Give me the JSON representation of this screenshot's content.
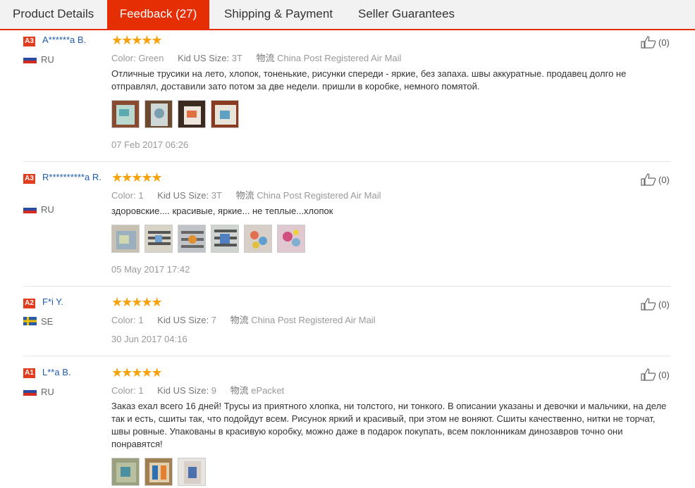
{
  "tabs": [
    {
      "label": "Product Details"
    },
    {
      "label": "Feedback (27)"
    },
    {
      "label": "Shipping & Payment"
    },
    {
      "label": "Seller Guarantees"
    }
  ],
  "labels": {
    "color": "Color:",
    "size": "Kid US Size:",
    "logistics": "物流"
  },
  "reviews": [
    {
      "level": "A3",
      "user": "A******a B.",
      "country": "RU",
      "color": "Green",
      "size": "3T",
      "shipping": "China Post Registered Air Mail",
      "text": "Отличные трусики на лето, хлопок, тоненькие, рисунки спереди - яркие, без запаха. швы аккуратные. продавец долго не отправлял, доставили зато потом за две недели. пришли в коробке, немного помятой.",
      "date": "07 Feb 2017 06:26",
      "likes": "(0)"
    },
    {
      "level": "A3",
      "user": "R**********a R.",
      "country": "RU",
      "color": "1",
      "size": "3T",
      "shipping": "China Post Registered Air Mail",
      "text": "здоровские.... красивые, яркие... не теплые...хлопок",
      "date": "05 May 2017 17:42",
      "likes": "(0)"
    },
    {
      "level": "A2",
      "user": "F*i Y.",
      "country": "SE",
      "color": "1",
      "size": "7",
      "shipping": "China Post Registered Air Mail",
      "text": "",
      "date": "30 Jun 2017 04:16",
      "likes": "(0)"
    },
    {
      "level": "A1",
      "user": "L**a B.",
      "country": "RU",
      "color": "1",
      "size": "9",
      "shipping": "ePacket",
      "text": "Заказ ехал всего 16 дней! Трусы из приятного хлопка, ни толстого, ни тонкого. В описании указаны и девочки и мальчики, на деле так и есть, сшиты так, что подойдут всем. Рисунок яркий и красивый, при этом не воняют. Сшиты качественно, нитки не торчат, швы ровные. Упакованы в красивую коробку, можно даже в подарок покупать, всем поклонникам динозавров точно они понравятся!",
      "date": "",
      "likes": "(0)"
    }
  ],
  "colors": {
    "accent": "#e62e04",
    "star": "#f7a20b",
    "badge": "#e23c1f",
    "username": "#1f5bab"
  }
}
